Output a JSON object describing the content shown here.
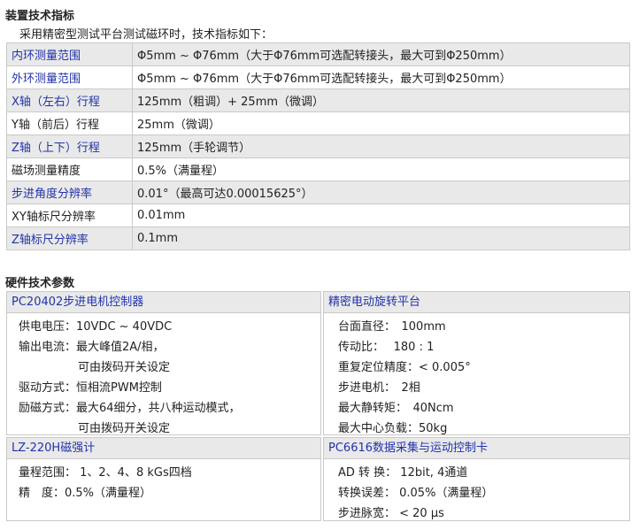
{
  "section1": {
    "title": "装置技术指标",
    "intro": "采用精密型测试平台测试磁环时，技术指标如下："
  },
  "spec_rows": [
    {
      "key": "内环测量范围",
      "value": "Φ5mm ~ Φ76mm（大于Φ76mm可选配转接头，最大可到Φ250mm）"
    },
    {
      "key": "外环测量范围",
      "value": "Φ5mm ~ Φ76mm（大于Φ76mm可选配转接头，最大可到Φ250mm）"
    },
    {
      "key": "X轴（左右）行程",
      "value": "125mm（粗调）+ 25mm（微调）"
    },
    {
      "key": "Y轴（前后）行程",
      "value": "25mm（微调）"
    },
    {
      "key": "Z轴（上下）行程",
      "value": "125mm（手轮调节）"
    },
    {
      "key": "磁场测量精度",
      "value": "0.5%（满量程）"
    },
    {
      "key": "步进角度分辨率",
      "value": "0.01°（最高可达0.00015625°）"
    },
    {
      "key": "XY轴标尺分辨率",
      "value": "0.01mm"
    },
    {
      "key": "Z轴标尺分辨率",
      "value": "0.1mm"
    }
  ],
  "section2": {
    "title": "硬件技术参数"
  },
  "panels": {
    "controller": {
      "title": "PC20402步进电机控制器",
      "lines": [
        "供电电压：10VDC ~ 40VDC",
        "输出电流：最大峰值2A/相，",
        "可由拨码开关设定",
        "驱动方式：恒相流PWM控制",
        "励磁方式：最大64细分，共八种运动模式，",
        "可由拨码开关设定"
      ]
    },
    "platform": {
      "title": "精密电动旋转平台",
      "lines": [
        "台面直径：　100mm",
        "传动比：　 180 : 1",
        "重复定位精度：< 0.005°",
        "步进电机：　2相",
        "最大静转矩：　40Ncm",
        "最大中心负载：50kg"
      ]
    },
    "gaussmeter": {
      "title": "LZ-220H磁强计",
      "lines": [
        "量程范围： 1、2、4、8 kGs四档",
        "精　度：0.5%（满量程）"
      ]
    },
    "daq": {
      "title": "PC6616数据采集与运动控制卡",
      "lines": [
        "AD 转 换： 12bit, 4通道",
        "转换误差： 0.05%（满量程）",
        "步进脉宽： < 20 μs"
      ]
    }
  },
  "colors": {
    "label_blue": "#2233aa",
    "shade": "#e9e9e9",
    "border": "#c9c9c9"
  }
}
